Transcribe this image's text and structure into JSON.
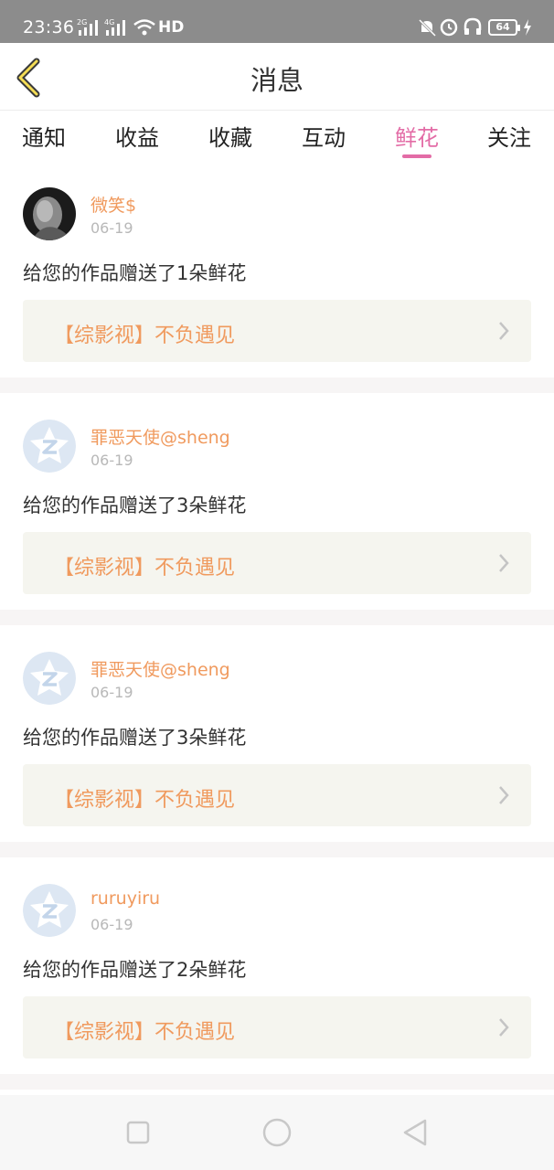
{
  "status_bar": {
    "time": "23:36",
    "network_1": "2G",
    "network_2": "4G",
    "hd": "HD",
    "battery": "64"
  },
  "header": {
    "title": "消息"
  },
  "tabs": [
    {
      "label": "通知"
    },
    {
      "label": "收益"
    },
    {
      "label": "收藏"
    },
    {
      "label": "互动"
    },
    {
      "label": "鲜花"
    },
    {
      "label": "关注"
    }
  ],
  "active_tab": "鲜花",
  "messages": [
    {
      "user": "微笑$",
      "date": "06-19",
      "text": "给您的作品赠送了1朵鲜花",
      "work": "【综影视】不负遇见",
      "avatar": "photo"
    },
    {
      "user": "罪恶天使@sheng",
      "date": "06-19",
      "text": "给您的作品赠送了3朵鲜花",
      "work": "【综影视】不负遇见",
      "avatar": "default"
    },
    {
      "user": "罪恶天使@sheng",
      "date": "06-19",
      "text": "给您的作品赠送了3朵鲜花",
      "work": "【综影视】不负遇见",
      "avatar": "default"
    },
    {
      "user": "ruruyiru",
      "date": "06-19",
      "text": "给您的作品赠送了2朵鲜花",
      "work": "【综影视】不负遇见",
      "avatar": "default"
    }
  ],
  "colors": {
    "accent": "#e36ca6",
    "username": "#f09a5e",
    "work_bg": "#f5f5ef",
    "status_bar": "#8c8c8c"
  }
}
